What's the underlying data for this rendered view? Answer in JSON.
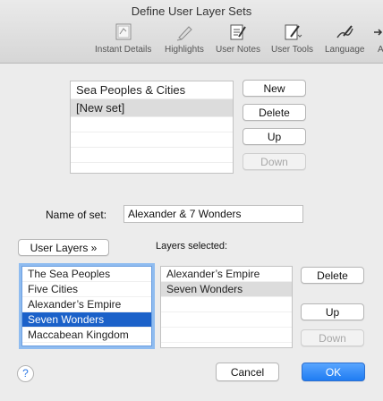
{
  "window": {
    "title": "Define User Layer Sets"
  },
  "toolbar": {
    "items": [
      {
        "label": "Instant Details",
        "icon": "instant-details-icon"
      },
      {
        "label": "Highlights",
        "icon": "highlighter-icon"
      },
      {
        "label": "User Notes",
        "icon": "user-notes-icon"
      },
      {
        "label": "User Tools",
        "icon": "user-tools-icon"
      },
      {
        "label": "Language",
        "icon": "language-icon"
      },
      {
        "label": "Ar",
        "icon": "more-icon"
      }
    ]
  },
  "sets": {
    "items": [
      "Sea Peoples & Cities",
      "[New set]"
    ],
    "selected_index": 1,
    "buttons": {
      "new": "New",
      "delete": "Delete",
      "up": "Up",
      "down": "Down"
    }
  },
  "name_field": {
    "label": "Name of set:",
    "value": "Alexander & 7 Wonders"
  },
  "user_layers": {
    "button": "User Layers »",
    "items": [
      "The Sea Peoples",
      "Five Cities",
      "Alexander’s Empire",
      "Seven Wonders",
      "Maccabean Kingdom"
    ],
    "selected_index": 3
  },
  "selected_layers": {
    "label": "Layers selected:",
    "items": [
      "Alexander’s Empire",
      "Seven Wonders"
    ],
    "selected_index": 1,
    "buttons": {
      "delete": "Delete",
      "up": "Up",
      "down": "Down"
    }
  },
  "footer": {
    "help": "?",
    "cancel": "Cancel",
    "ok": "OK"
  },
  "colors": {
    "accent": "#1f7cf2",
    "selection": "#1b61c9"
  }
}
